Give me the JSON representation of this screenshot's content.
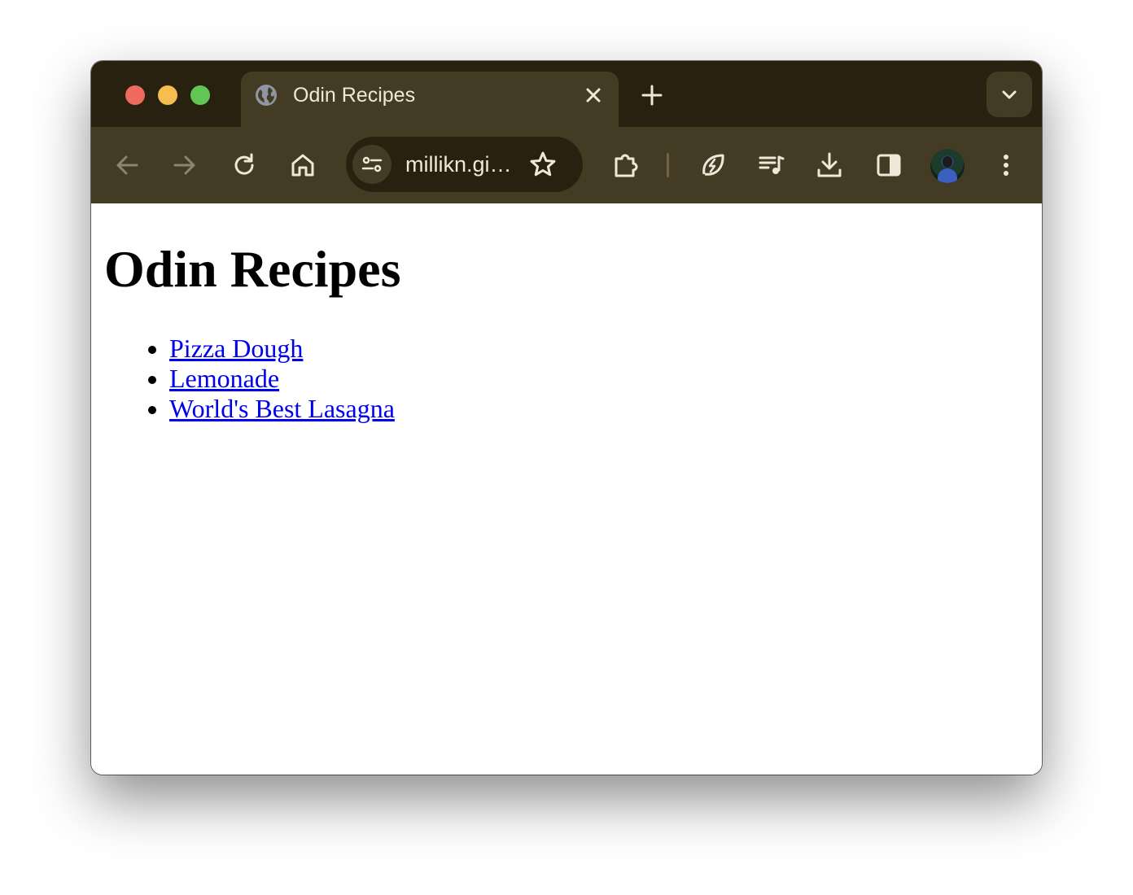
{
  "browser": {
    "tab": {
      "title": "Odin Recipes",
      "favicon": "globe-icon"
    },
    "toolbar": {
      "url_display": "millikn.gi…",
      "icons": [
        "back-arrow-icon",
        "forward-arrow-icon",
        "reload-icon",
        "home-icon",
        "site-info-icon",
        "bookmark-star-icon",
        "extensions-puzzle-icon",
        "energy-saver-leaf-icon",
        "media-queue-icon",
        "download-icon",
        "side-panel-icon",
        "profile-avatar",
        "more-menu-icon"
      ]
    },
    "colors": {
      "tabbar_bg": "#29210f",
      "toolbar_bg": "#433b24",
      "icon_color": "#efe8d8",
      "link_color": "#0000ee"
    }
  },
  "page": {
    "heading": "Odin Recipes",
    "recipes": [
      {
        "label": "Pizza Dough"
      },
      {
        "label": "Lemonade"
      },
      {
        "label": "World's Best Lasagna"
      }
    ]
  }
}
